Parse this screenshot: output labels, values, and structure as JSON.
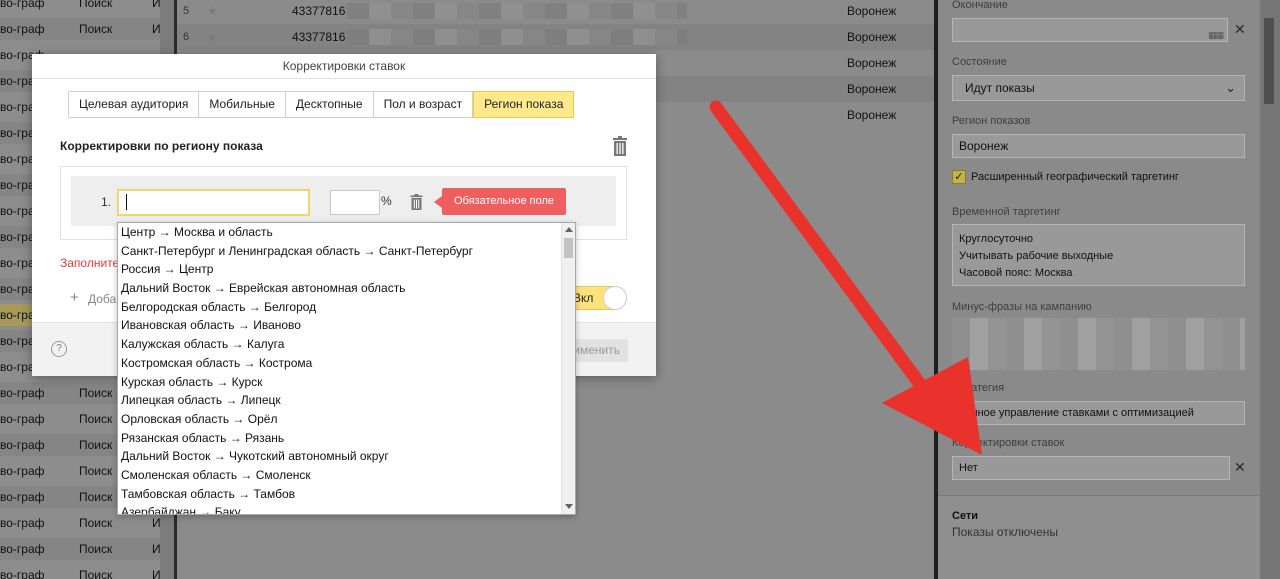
{
  "background": {
    "left_rows": [
      {
        "col1": "во-граф",
        "col2": "Поиск",
        "col3": "И"
      },
      {
        "col1": "во-граф",
        "col2": "Поиск",
        "col3": "И"
      },
      {
        "col1": "во-граф",
        "col2": "",
        "col3": ""
      },
      {
        "col1": "во-граф",
        "col2": "",
        "col3": ""
      },
      {
        "col1": "во-граф",
        "col2": "",
        "col3": ""
      },
      {
        "col1": "во-граф",
        "col2": "",
        "col3": ""
      },
      {
        "col1": "во-граф",
        "col2": "",
        "col3": ""
      },
      {
        "col1": "во-граф",
        "col2": "",
        "col3": ""
      },
      {
        "col1": "во-граф",
        "col2": "",
        "col3": ""
      },
      {
        "col1": "во-граф",
        "col2": "",
        "col3": ""
      },
      {
        "col1": "во-граф",
        "col2": "",
        "col3": ""
      },
      {
        "col1": "во-граф",
        "col2": "",
        "col3": ""
      },
      {
        "col1": "во-граф",
        "col2": "",
        "col3": ""
      },
      {
        "col1": "во-граф",
        "col2": "",
        "col3": ""
      },
      {
        "col1": "во-граф",
        "col2": "",
        "col3": ""
      },
      {
        "col1": "во-граф",
        "col2": "Поиск",
        "col3": "И"
      },
      {
        "col1": "во-граф",
        "col2": "Поиск",
        "col3": "И"
      },
      {
        "col1": "во-граф",
        "col2": "Поиск",
        "col3": "И"
      },
      {
        "col1": "во-граф",
        "col2": "Поиск",
        "col3": "И"
      },
      {
        "col1": "во-граф",
        "col2": "Поиск",
        "col3": "И"
      },
      {
        "col1": "во-граф",
        "col2": "Поиск",
        "col3": "И"
      },
      {
        "col1": "во-граф",
        "col2": "Поиск",
        "col3": "И"
      },
      {
        "col1": "во-граф",
        "col2": "Поиск",
        "col3": "И"
      }
    ],
    "table_rows": [
      {
        "num": "5",
        "id": "43377816",
        "city": "Воронеж"
      },
      {
        "num": "6",
        "id": "43377816",
        "city": "Воронеж"
      },
      {
        "num": "",
        "id": "",
        "city": "Воронеж"
      },
      {
        "num": "",
        "id": "",
        "city": "Воронеж"
      },
      {
        "num": "",
        "id": "",
        "city": "Воронеж"
      }
    ],
    "right_panel": {
      "end_label": "Окончание",
      "state_label": "Состояние",
      "state_value": "Идут показы",
      "region_label": "Регион показов",
      "region_value": "Воронеж",
      "geo_check_label": "Расширенный географический таргетинг",
      "time_label": "Временной таргетинг",
      "time_lines": [
        "Круглосуточно",
        "Учитывать рабочие выходные",
        "Часовой пояс: Москва"
      ],
      "minus_label": "Минус-фразы на кампанию",
      "strategy_label": "Стратегия",
      "strategy_value": "Ручное управление ставками с оптимизацией",
      "bid_adj_label": "Корректировки ставок",
      "bid_adj_value": "Нет",
      "networks_title": "Сети",
      "networks_sub": "Показы отключены"
    }
  },
  "modal": {
    "title": "Корректировки ставок",
    "tabs": [
      {
        "label": "Целевая аудитория",
        "active": false
      },
      {
        "label": "Мобильные",
        "active": false
      },
      {
        "label": "Десктопные",
        "active": false
      },
      {
        "label": "Пол и возраст",
        "active": false
      },
      {
        "label": "Регион показа",
        "active": true
      }
    ],
    "section_title": "Корректировки по региону показа",
    "row_number": "1.",
    "region_input_value": "",
    "percent_value": "",
    "percent_sign": "%",
    "required_badge": "Обязательное поле",
    "error_text": "Заполните",
    "add_label": "Добавить",
    "toggle_label": "Вкл",
    "apply_label": "Применить",
    "help_label": "?"
  },
  "dropdown": {
    "options": [
      "Центр → Москва и область",
      "Санкт-Петербург и Ленинградская область → Санкт-Петербург",
      "Россия → Центр",
      "Дальний Восток → Еврейская автономная область",
      "Белгородская область → Белгород",
      "Ивановская область → Иваново",
      "Калужская область → Калуга",
      "Костромская область → Кострома",
      "Курская область → Курск",
      "Липецкая область → Липецк",
      "Орловская область → Орёл",
      "Рязанская область → Рязань",
      "Дальний Восток → Чукотский автономный округ",
      "Смоленская область → Смоленск",
      "Тамбовская область → Тамбов",
      "Азербайджан → Баку"
    ]
  },
  "colors": {
    "active_tab": "#ffe98a",
    "required_badge": "#f05f5f",
    "error_text": "#e83b3b",
    "arrow": "#e8322b",
    "input_focus_border": "#f4d56a"
  }
}
